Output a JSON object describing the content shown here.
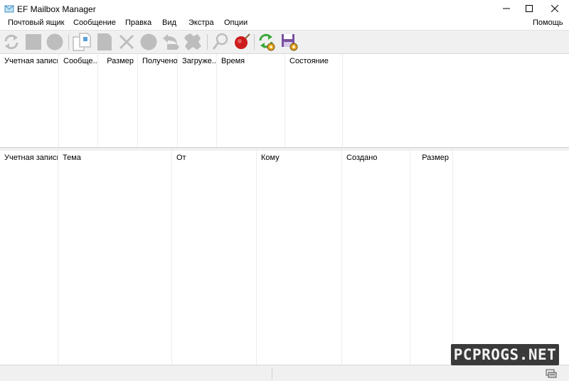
{
  "window": {
    "title": "EF Mailbox Manager"
  },
  "menu": {
    "items": [
      "Почтовый ящик",
      "Сообщение",
      "Правка",
      "Вид",
      "Экстра",
      "Опции"
    ],
    "help": "Помощь"
  },
  "toolbar": {
    "buttons": [
      {
        "icon": "refresh-icon"
      },
      {
        "icon": "stop-square-icon"
      },
      {
        "icon": "circle-icon"
      },
      {
        "icon": "copy-pages-icon"
      },
      {
        "icon": "page-icon"
      },
      {
        "icon": "delete-x-icon"
      },
      {
        "icon": "circle-icon"
      },
      {
        "icon": "reply-icon"
      },
      {
        "icon": "reply-all-icon"
      },
      {
        "icon": "search-icon"
      },
      {
        "icon": "stop-sign-icon"
      },
      {
        "icon": "sync-icon"
      },
      {
        "icon": "save-settings-icon"
      }
    ],
    "colors": {
      "disabled": "#c4c4c4",
      "green": "#3aa83a",
      "red": "#cc1c1c",
      "purple": "#7a4fa0",
      "gold": "#e0a020"
    }
  },
  "accounts_table": {
    "columns": [
      "Учетная запись",
      "Сообще...",
      "Размер",
      "Получено",
      "Загруже...",
      "Время",
      "Состояние"
    ]
  },
  "messages_table": {
    "columns": [
      "Учетная запись",
      "Тема",
      "От",
      "Кому",
      "Создано",
      "Размер"
    ]
  },
  "watermark": {
    "text": "PCPROGS.NET"
  }
}
